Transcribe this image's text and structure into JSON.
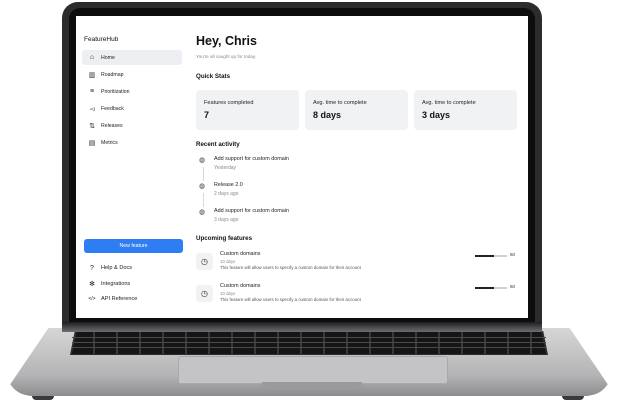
{
  "app": {
    "name": "FeatureHub"
  },
  "sidebar": {
    "items": [
      {
        "label": "Home",
        "icon": "home-icon",
        "glyph": "⌂"
      },
      {
        "label": "Roadmap",
        "icon": "map-icon",
        "glyph": "▥"
      },
      {
        "label": "Prioritization",
        "icon": "list-icon",
        "glyph": "≡"
      },
      {
        "label": "Feedback",
        "icon": "megaphone-icon",
        "glyph": "◅"
      },
      {
        "label": "Releases",
        "icon": "sort-arrows-icon",
        "glyph": "⇅"
      },
      {
        "label": "Metrics",
        "icon": "bar-chart-icon",
        "glyph": "▤"
      }
    ],
    "new_feature_label": "New feature",
    "bottom": [
      {
        "label": "Help & Docs",
        "icon": "help-icon",
        "glyph": "?"
      },
      {
        "label": "Integrations",
        "icon": "plug-icon",
        "glyph": "✻"
      },
      {
        "label": "API Reference",
        "icon": "code-icon",
        "glyph": "</>"
      }
    ]
  },
  "header": {
    "greeting": "Hey, Chris",
    "subtitle": "You're all caught up for today."
  },
  "quick_stats": {
    "title": "Quick Stats",
    "cards": [
      {
        "label": "Features completed",
        "value": "7"
      },
      {
        "label": "Avg. time to complete",
        "value": "8 days"
      },
      {
        "label": "Avg. time to complete",
        "value": "3 days"
      }
    ]
  },
  "recent_activity": {
    "title": "Recent activity",
    "items": [
      {
        "title": "Add support for custom domain",
        "time": "Yesterday"
      },
      {
        "title": "Release 2.0",
        "time": "2 days ago"
      },
      {
        "title": "Add support for custom domain",
        "time": "3 days ago"
      }
    ]
  },
  "upcoming": {
    "title": "Upcoming features",
    "items": [
      {
        "title": "Custom domains",
        "duration": "10 days",
        "description": "This feature will allow users to specify a custom domain for their account",
        "progress": 60,
        "progress_label": "60"
      },
      {
        "title": "Custom domains",
        "duration": "10 days",
        "description": "This feature will allow users to specify a custom domain for their account",
        "progress": 60,
        "progress_label": "60"
      }
    ]
  },
  "colors": {
    "accent": "#2f7df2",
    "card_bg": "#f1f2f4",
    "active_nav_bg": "#eeeff2"
  }
}
